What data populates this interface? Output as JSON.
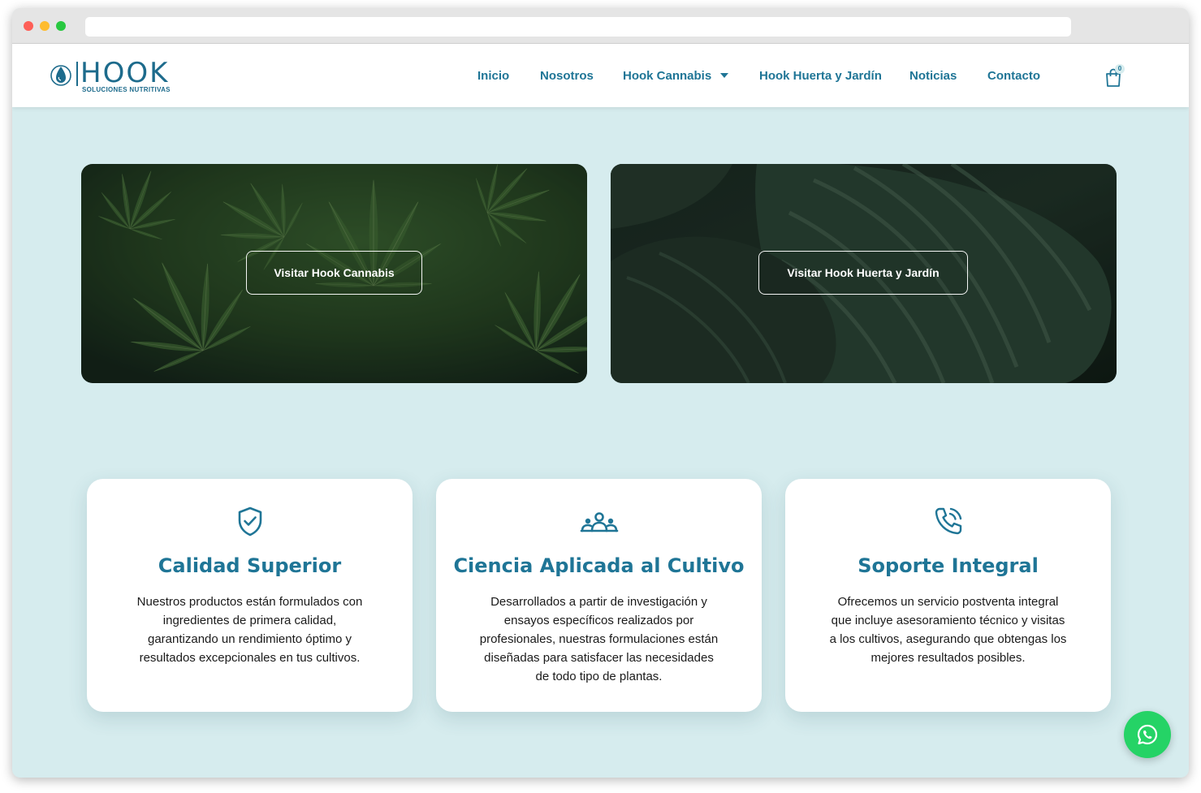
{
  "browser": {
    "url": ""
  },
  "brand": {
    "name": "HOOK",
    "tagline": "SOLUCIONES NUTRITIVAS",
    "color": "#1d6b8c"
  },
  "nav": {
    "items": [
      "Inicio",
      "Nosotros",
      "Hook Cannabis",
      "Hook Huerta y Jardín",
      "Noticias",
      "Contacto"
    ],
    "dropdown_item_icon": "caret-down-icon",
    "cart_count": "0",
    "cart_icon": "shopping-bag-icon"
  },
  "banners": [
    {
      "button": "Visitar Hook Cannabis"
    },
    {
      "button": "Visitar Hook Huerta y Jardín"
    }
  ],
  "features": [
    {
      "icon": "shield-check-icon",
      "title": "Calidad Superior",
      "lines": [
        "Nuestros productos están formulados con",
        "ingredientes de primera calidad,",
        "garantizando un rendimiento óptimo y",
        "resultados excepcionales en tus cultivos."
      ]
    },
    {
      "icon": "users-group-icon",
      "title": "Ciencia Aplicada al Cultivo",
      "lines": [
        "Desarrollados a partir de investigación y",
        "ensayos específicos realizados por",
        "profesionales, nuestras formulaciones están",
        "diseñadas para satisfacer las necesidades",
        "de todo tipo de plantas."
      ]
    },
    {
      "icon": "phone-call-icon",
      "title": "Soporte Integral",
      "lines": [
        "Ofrecemos un servicio postventa integral",
        "que incluye asesoramiento técnico y visitas",
        "a los cultivos, asegurando que obtengas los",
        "mejores resultados posibles."
      ]
    }
  ],
  "whatsapp": {
    "icon": "whatsapp-icon",
    "color": "#25d366"
  },
  "colors": {
    "accent": "#1f7596",
    "page_background": "#d6ecee"
  }
}
